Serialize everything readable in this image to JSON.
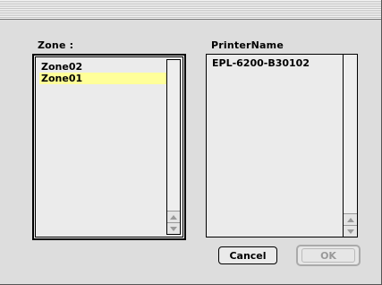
{
  "zone": {
    "label": "Zone :",
    "items": [
      "Zone02",
      "Zone01"
    ],
    "selected": "Zone01"
  },
  "printer": {
    "label": "PrinterName",
    "items": [
      "EPL-6200-B30102"
    ]
  },
  "buttons": {
    "cancel": "Cancel",
    "ok": "OK"
  },
  "colors": {
    "selection": "#ffff99",
    "window_bg": "#dddddd"
  }
}
